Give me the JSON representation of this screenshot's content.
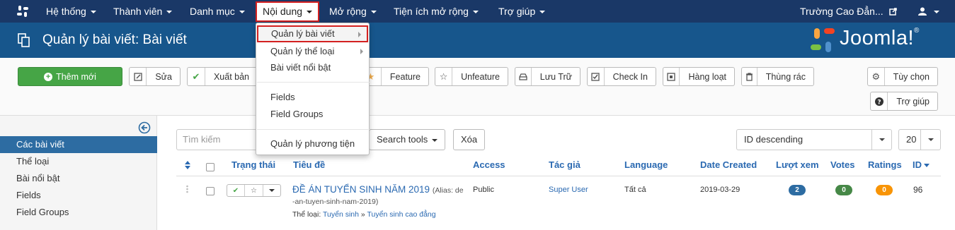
{
  "colors": {
    "navbar": "#1a3867",
    "header": "#17568c",
    "new_button": "#46a546",
    "sidebar_active": "#2d6ca2",
    "link": "#2a69b1",
    "highlight_border": "#d32020"
  },
  "navbar": {
    "menus": [
      "Hệ thống",
      "Thành viên",
      "Danh mục",
      "Nội dung",
      "Mở rộng",
      "Tiện ích mở rộng",
      "Trợ giúp"
    ],
    "site_name": "Trường Cao Đẳn...",
    "user_icon": "user-icon",
    "external_icon": "external-link-icon"
  },
  "header": {
    "title": "Quản lý bài viết: Bài viết",
    "brand": "Joomla!",
    "brand_mark": "®"
  },
  "toolbar": {
    "new": "Thêm mới",
    "buttons": [
      "Sửa",
      "Xuất bản",
      "Feature",
      "Unfeature",
      "Lưu Trữ",
      "Check In",
      "Hàng loạt",
      "Thùng rác"
    ],
    "options": "Tùy chọn",
    "help": "Trợ giúp"
  },
  "dropdown": {
    "items": [
      "Quản lý bài viết",
      "Quản lý thể loại",
      "Bài viết nổi bật",
      "Fields",
      "Field Groups",
      "Quản lý phương tiện"
    ]
  },
  "sidebar": {
    "items": [
      "Các bài viết",
      "Thể loại",
      "Bài nổi bật",
      "Fields",
      "Field Groups"
    ]
  },
  "filters": {
    "search_placeholder": "Tìm kiếm",
    "search_tools": "Search tools",
    "clear": "Xóa",
    "ordering": "ID descending",
    "limit": "20"
  },
  "table": {
    "columns": [
      "Trạng thái",
      "Tiêu đề",
      "Access",
      "Tác giả",
      "Language",
      "Date Created",
      "Lượt xem",
      "Votes",
      "Ratings",
      "ID"
    ],
    "rows": [
      {
        "title": "ĐỀ ÁN TUYỂN SINH NĂM 2019",
        "alias_line1": "(Alias: de",
        "alias_line2": "-an-tuyen-sinh-nam-2019)",
        "category_label": "Thể loại:",
        "category_parent": "Tuyển sinh",
        "category_sep": "»",
        "category_child": "Tuyển sinh cao đẳng",
        "access": "Public",
        "author": "Super User",
        "language": "Tất cả",
        "date": "2019-03-29",
        "hits": "2",
        "votes": "0",
        "ratings": "0",
        "id": "96"
      }
    ]
  }
}
